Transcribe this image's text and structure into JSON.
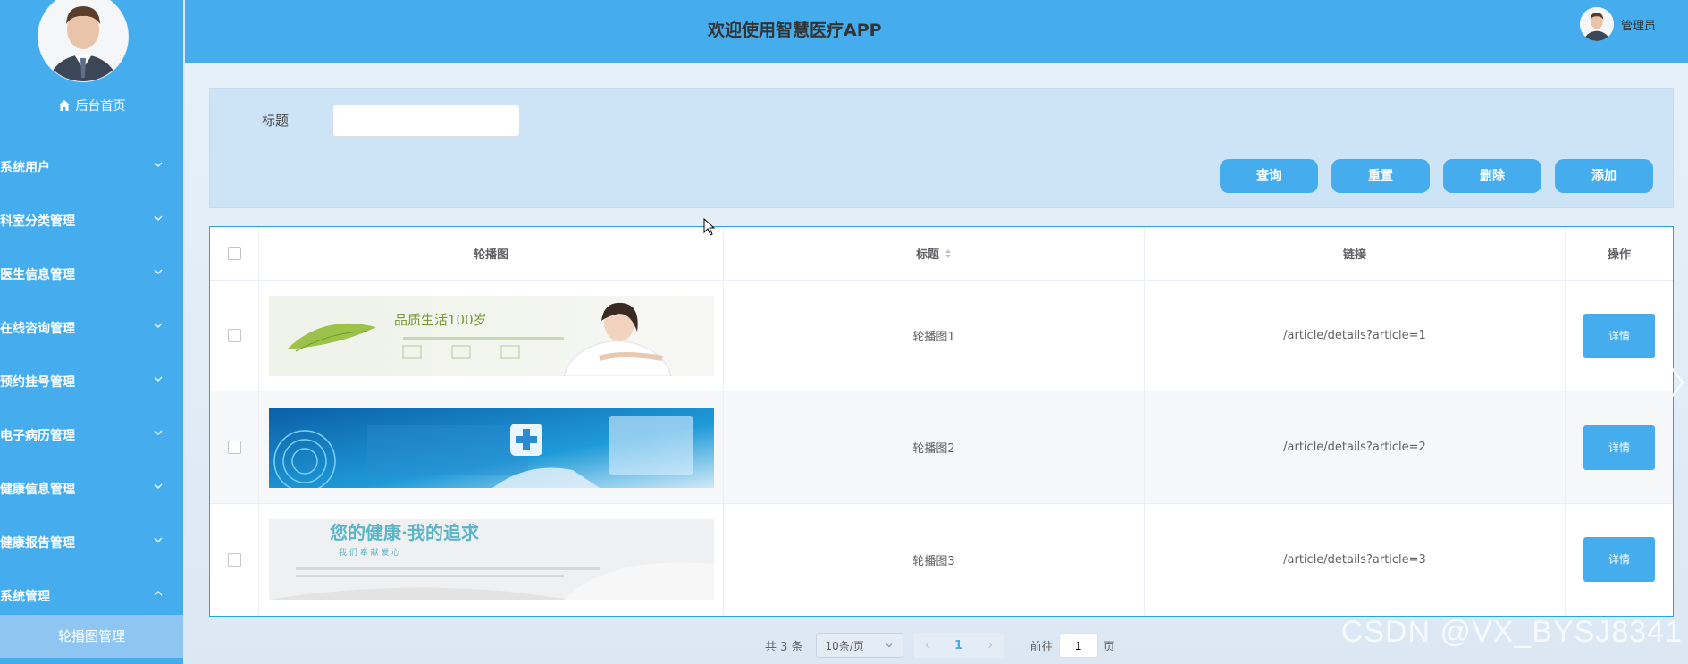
{
  "header": {
    "title": "欢迎使用智慧医疗APP",
    "user": "管理员"
  },
  "sidebar": {
    "home": "后台首页",
    "items": [
      {
        "label": "系统用户"
      },
      {
        "label": "科室分类管理"
      },
      {
        "label": "医生信息管理"
      },
      {
        "label": "在线咨询管理"
      },
      {
        "label": "预约挂号管理"
      },
      {
        "label": "电子病历管理"
      },
      {
        "label": "健康信息管理"
      },
      {
        "label": "健康报告管理"
      },
      {
        "label": "系统管理"
      }
    ],
    "active_sub": "轮播图管理"
  },
  "search": {
    "label": "标题",
    "value": "",
    "buttons": {
      "query": "查询",
      "reset": "重置",
      "delete": "删除",
      "add": "添加"
    }
  },
  "table": {
    "headers": {
      "image": "轮播图",
      "title": "标题",
      "link": "链接",
      "action": "操作"
    },
    "rows": [
      {
        "banner_text": "品质生活100岁",
        "title": "轮播图1",
        "link": "/article/details?article=1",
        "action": "详情"
      },
      {
        "banner_text": "",
        "title": "轮播图2",
        "link": "/article/details?article=2",
        "action": "详情"
      },
      {
        "banner_text": "您的健康·我的追求",
        "banner_sub": "我 们 奉 献 爱 心",
        "title": "轮播图3",
        "link": "/article/details?article=3",
        "action": "详情"
      }
    ]
  },
  "pagination": {
    "total": "共 3 条",
    "page_size": "10条/页",
    "current_page": "1",
    "goto_prefix": "前往",
    "goto_value": "1",
    "goto_suffix": "页"
  },
  "watermark": "CSDN @VX_BYSJ8341",
  "colors": {
    "primary": "#45adee",
    "sub_active": "#8ec6f1",
    "border": "#2aa3e0"
  }
}
